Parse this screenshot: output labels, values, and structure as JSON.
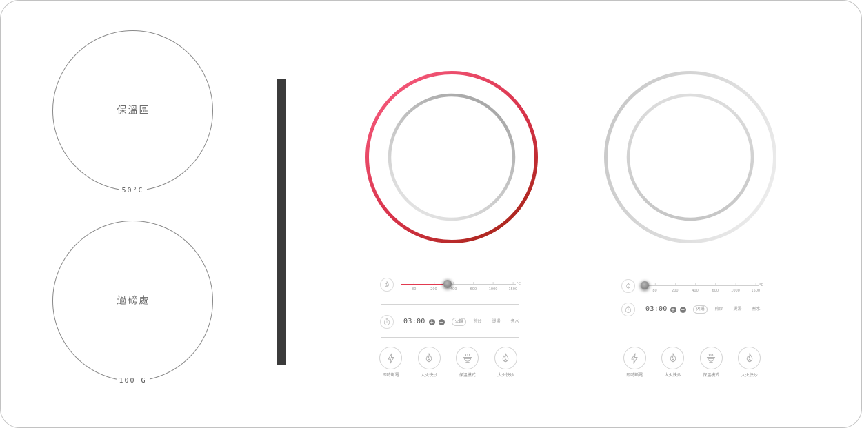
{
  "zones": [
    {
      "label": "保溫區",
      "reading": "50°C"
    },
    {
      "label": "過磅處",
      "reading": "100 G"
    }
  ],
  "burners": [
    {
      "heating": true,
      "temperature": {
        "ticks": [
          "80",
          "200",
          "400",
          "600",
          "1000",
          "1500"
        ],
        "unit": "°C",
        "level": 0.41
      },
      "timer": {
        "time": "03:00",
        "plus": "+",
        "minus": "−"
      },
      "modes": [
        {
          "label": "火鍋",
          "selected": true
        },
        {
          "label": "煎炒",
          "selected": false
        },
        {
          "label": "燙湯",
          "selected": false
        },
        {
          "label": "煮水",
          "selected": false
        }
      ],
      "actions": [
        {
          "label": "即時斷電",
          "icon": "lightning-icon"
        },
        {
          "label": "大火快炒",
          "icon": "flame-icon"
        },
        {
          "label": "保溫模式",
          "icon": "bowl-icon"
        },
        {
          "label": "大火快炒",
          "icon": "flame-icon"
        }
      ]
    },
    {
      "heating": false,
      "temperature": {
        "ticks": [
          "80",
          "200",
          "400",
          "600",
          "1000",
          "1500"
        ],
        "unit": "°C",
        "level": 0.03
      },
      "timer": {
        "time": "03:00",
        "plus": "+",
        "minus": "−"
      },
      "modes": [
        {
          "label": "火鍋",
          "selected": true
        },
        {
          "label": "煎炒",
          "selected": false
        },
        {
          "label": "燙湯",
          "selected": false
        },
        {
          "label": "煮水",
          "selected": false
        }
      ],
      "actions": [
        {
          "label": "即時斷電",
          "icon": "lightning-icon"
        },
        {
          "label": "大火快炒",
          "icon": "flame-icon"
        },
        {
          "label": "保溫模式",
          "icon": "bowl-icon"
        },
        {
          "label": "大火快炒",
          "icon": "flame-icon"
        }
      ]
    }
  ],
  "colors": {
    "active_ring": [
      "#f4587a",
      "#d8334a",
      "#a9261b"
    ],
    "active_inner": [
      "#a4a4a4",
      "#e6e6e6"
    ],
    "idle_ring": [
      "#c8c8c8",
      "#ececec"
    ],
    "idle_inner": [
      "#dddddd",
      "#c6c6c6"
    ],
    "slider_fill": "#e23a50",
    "divider_bar": "#3b3b3b"
  }
}
